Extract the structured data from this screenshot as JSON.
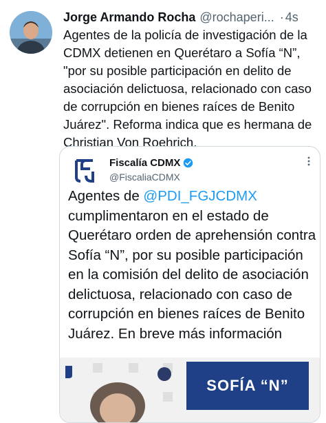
{
  "tweet": {
    "author_name": "Jorge Armando Rocha",
    "author_handle": "@rochaperi...",
    "separator": "·",
    "time": "4s",
    "text": "Agentes de la policía de investigación de la CDMX detienen en Querétaro a Sofía “N”, \"por su posible participación en delito de asociación delictuosa, relacionado con caso de corrupción en bienes raíces de Benito Juárez\". Reforma indica que es hermana de Christian Von Roehrich."
  },
  "quoted_tweet": {
    "author_name": "Fiscalía CDMX",
    "author_handle": "@FiscaliaCDMX",
    "text_before": "Agentes de ",
    "mention": "@PDI_FGJCDMX",
    "text_after": " cumplimentaron en el estado de Querétaro orden de aprehensión contra Sofía “N”, por su posible participación en la comisión del delito de asociación delictuosa, relacionado con caso de corrupción en bienes raíces de Benito Juárez. En breve más información",
    "image_banner": "SOFÍA “N”"
  },
  "icons": {
    "verified": "verified-badge-icon",
    "more": "more-options-icon",
    "logo": "fgj-logo-icon"
  },
  "colors": {
    "accent": "#1d9bf0",
    "banner": "#1f3f86",
    "text": "#0f1419",
    "secondary": "#536471"
  }
}
